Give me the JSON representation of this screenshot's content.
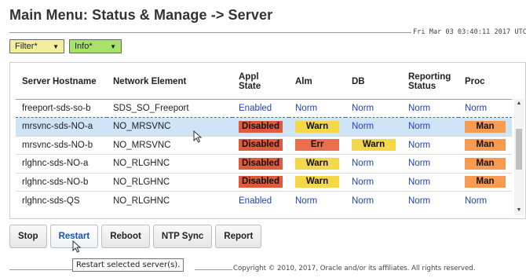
{
  "header": {
    "title": "Main Menu: Status & Manage -> Server",
    "datetime": "Fri Mar 03 03:40:11 2017 UTC"
  },
  "filters": {
    "filter_label": "Filter*",
    "info_label": "Info*"
  },
  "table": {
    "columns": [
      "Server Hostname",
      "Network Element",
      "Appl State",
      "Alm",
      "DB",
      "Reporting Status",
      "Proc"
    ],
    "rows": [
      {
        "hostname": "freeport-sds-so-b",
        "ne": "SDS_SO_Freeport",
        "appl": "Enabled",
        "alm": "Norm",
        "db": "Norm",
        "reporting": "Norm",
        "proc": "Norm"
      },
      {
        "hostname": "mrsvnc-sds-NO-a",
        "ne": "NO_MRSVNC",
        "appl": "Disabled",
        "alm": "Warn",
        "db": "Norm",
        "reporting": "Norm",
        "proc": "Man"
      },
      {
        "hostname": "mrsvnc-sds-NO-b",
        "ne": "NO_MRSVNC",
        "appl": "Disabled",
        "alm": "Err",
        "db": "Warn",
        "reporting": "Norm",
        "proc": "Man"
      },
      {
        "hostname": "rlghnc-sds-NO-a",
        "ne": "NO_RLGHNC",
        "appl": "Disabled",
        "alm": "Warn",
        "db": "Norm",
        "reporting": "Norm",
        "proc": "Man"
      },
      {
        "hostname": "rlghnc-sds-NO-b",
        "ne": "NO_RLGHNC",
        "appl": "Disabled",
        "alm": "Warn",
        "db": "Norm",
        "reporting": "Norm",
        "proc": "Man"
      },
      {
        "hostname": "rlghnc-sds-QS",
        "ne": "NO_RLGHNC",
        "appl": "Enabled",
        "alm": "Norm",
        "db": "Norm",
        "reporting": "Norm",
        "proc": "Norm"
      }
    ],
    "selected_row": "mrsvnc-sds-NO-a"
  },
  "actions": {
    "stop": "Stop",
    "restart": "Restart",
    "reboot": "Reboot",
    "ntp_sync": "NTP Sync",
    "report": "Report"
  },
  "tooltip": "Restart selected server(s).",
  "footer": {
    "copyright": "Copyright © 2010, 2017, Oracle and/or its affiliates. All rights reserved."
  },
  "status_colors": {
    "Disabled": "#e25a3d",
    "Warn": "#f5d84a",
    "Err": "#e96f4f",
    "Man": "#f79a52",
    "Norm": "#1f3fbf",
    "Enabled": "#1f3fbf"
  },
  "icons": {
    "dropdown": "chevron-down-icon",
    "pointer": "mouse-pointer-icon"
  }
}
